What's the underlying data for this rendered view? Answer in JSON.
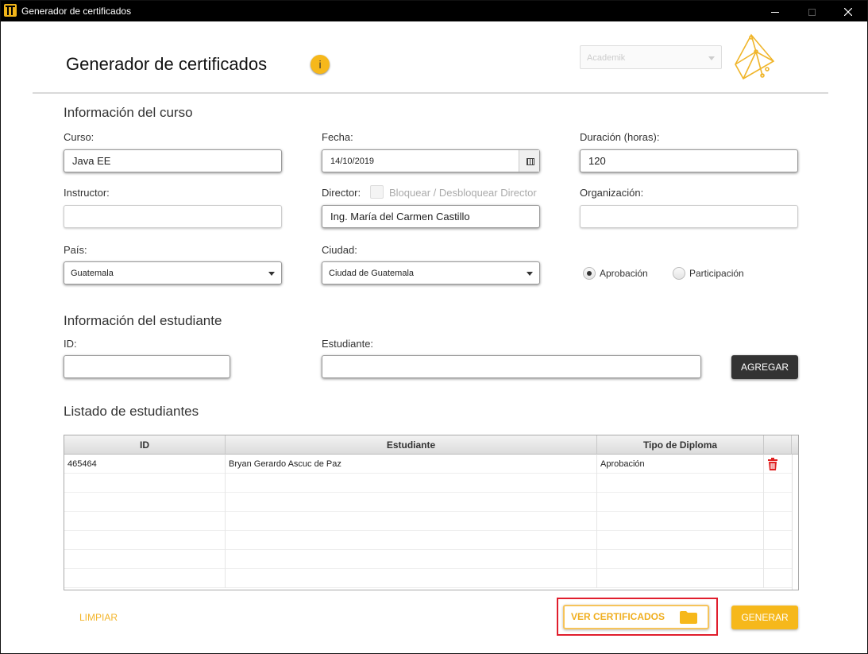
{
  "window": {
    "title": "Generador de certificados"
  },
  "header": {
    "title": "Generador de certificados",
    "info_glyph": "i",
    "organization_selected": "Academik"
  },
  "course_section": {
    "title": "Información del curso",
    "curso_label": "Curso:",
    "curso_value": "Java EE",
    "fecha_label": "Fecha:",
    "fecha_value": "14/10/2019",
    "duracion_label": "Duración (horas):",
    "duracion_value": "120",
    "instructor_label": "Instructor:",
    "instructor_value": "",
    "director_label": "Director:",
    "director_lock_label": "Bloquear / Desbloquear Director",
    "director_value": "Ing. María del Carmen Castillo",
    "organizacion_label": "Organización:",
    "organizacion_value": "",
    "pais_label": "País:",
    "pais_value": "Guatemala",
    "ciudad_label": "Ciudad:",
    "ciudad_value": "Ciudad de Guatemala",
    "radio_aprobacion": "Aprobación",
    "radio_participacion": "Participación",
    "selected_type": "Aprobación"
  },
  "student_section": {
    "title": "Información del estudiante",
    "id_label": "ID:",
    "id_value": "",
    "student_label": "Estudiante:",
    "student_value": "",
    "add_button": "AGREGAR"
  },
  "list_section": {
    "title": "Listado de estudiantes",
    "columns": [
      "ID",
      "Estudiante",
      "Tipo de Diploma"
    ],
    "rows": [
      {
        "id": "465464",
        "name": "Bryan Gerardo Ascuc de Paz",
        "type": "Aprobación"
      }
    ]
  },
  "actions": {
    "clear": "LIMPIAR",
    "view_certificates": "VER CERTIFICADOS",
    "generate": "GENERAR"
  },
  "colors": {
    "accent": "#f6b81b",
    "highlight_box": "#e01e2d",
    "delete": "#e02020",
    "titlebar": "#000000"
  }
}
